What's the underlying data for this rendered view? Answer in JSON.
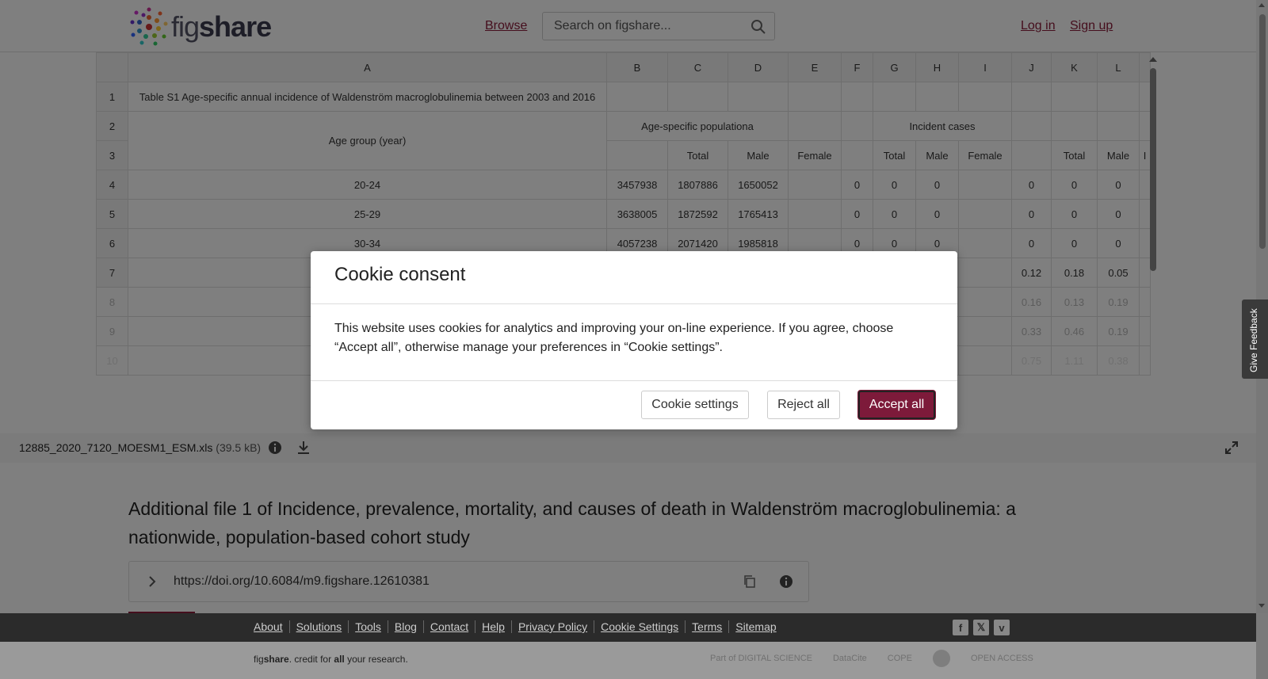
{
  "header": {
    "logo_text_light": "fig",
    "logo_text_bold": "share",
    "browse_label": "Browse",
    "search_placeholder": "Search on figshare...",
    "login_label": "Log in",
    "signup_label": "Sign up"
  },
  "spreadsheet": {
    "column_headers": [
      "A",
      "B",
      "C",
      "D",
      "E",
      "F",
      "G",
      "H",
      "I",
      "J",
      "K",
      "L"
    ],
    "row1": {
      "num": "1",
      "title": "Table S1 Age-specific annual incidence of Waldenström macroglobulinemia between 2003 and 2016"
    },
    "row2": {
      "num": "2",
      "age_group": "Age group (year)",
      "population_header": "Age-specific populationa",
      "incident_header": "Incident cases"
    },
    "row3": {
      "num": "3",
      "c": "Total",
      "d": "Male",
      "e": "Female",
      "g": "Total",
      "h": "Male",
      "i": "Female",
      "k": "Total",
      "l": "Male",
      "m": "I"
    },
    "data_rows": [
      {
        "num": "4",
        "age": "20-24",
        "b": "3457938",
        "c": "1807886",
        "d": "1650052",
        "f": "0",
        "g": "0",
        "h": "0",
        "j": "0",
        "k": "0",
        "l": "0"
      },
      {
        "num": "5",
        "age": "25-29",
        "b": "3638005",
        "c": "1872592",
        "d": "1765413",
        "f": "0",
        "g": "0",
        "h": "0",
        "j": "0",
        "k": "0",
        "l": "0"
      },
      {
        "num": "6",
        "age": "30-34",
        "b": "4057238",
        "c": "2071420",
        "d": "1985818",
        "f": "0",
        "g": "0",
        "h": "0",
        "j": "0",
        "k": "0",
        "l": "0"
      },
      {
        "num": "7",
        "age": "",
        "b": "",
        "c": "",
        "d": "",
        "f": "",
        "g": "",
        "h": "",
        "j": "0.12",
        "k": "0.18",
        "l": "0.05"
      },
      {
        "num": "8",
        "age": "",
        "b": "",
        "c": "",
        "d": "",
        "f": "",
        "g": "",
        "h": "",
        "j": "0.16",
        "k": "0.13",
        "l": "0.19"
      },
      {
        "num": "9",
        "age": "",
        "b": "",
        "c": "",
        "d": "",
        "f": "",
        "g": "",
        "h": "",
        "j": "0.33",
        "k": "0.46",
        "l": "0.19"
      },
      {
        "num": "10",
        "age": "",
        "b": "",
        "c": "",
        "d": "",
        "f": "",
        "g": "",
        "h": "",
        "j": "0.75",
        "k": "1.11",
        "l": "0.38"
      }
    ]
  },
  "filebar": {
    "filename": "12885_2020_7120_MOESM1_ESM.xls",
    "filesize": "(39.5 kB)"
  },
  "item": {
    "title": "Additional file 1 of Incidence, prevalence, mortality, and causes of death in Waldenström macroglobulinemia: a nationwide, population-based cohort study",
    "doi": "https://doi.org/10.6084/m9.figshare.12610381"
  },
  "footer": {
    "links": [
      "About",
      "Solutions",
      "Tools",
      "Blog",
      "Contact",
      "Help",
      "Privacy Policy",
      "Cookie Settings",
      "Terms",
      "Sitemap"
    ],
    "social": [
      "f",
      "𝕏",
      "v"
    ],
    "tagline_pre": "fig",
    "tagline_bold": "share",
    "tagline_mid": ". credit for ",
    "tagline_all": "all",
    "tagline_post": " your research.",
    "partners": [
      "Part of DIGITAL SCIENCE",
      "DataCite",
      "COPE",
      "",
      "OPEN ACCESS"
    ]
  },
  "feedback_label": "Give Feedback",
  "cookie_modal": {
    "title": "Cookie consent",
    "body": "This website uses cookies for analytics and improving your on-line experience. If you agree, choose “Accept all”, otherwise manage your preferences in “Cookie settings”.",
    "settings_label": "Cookie settings",
    "reject_label": "Reject all",
    "accept_label": "Accept all"
  },
  "colors": {
    "brand": "#8a1c3a",
    "accept_button": "#7d1a3a"
  }
}
